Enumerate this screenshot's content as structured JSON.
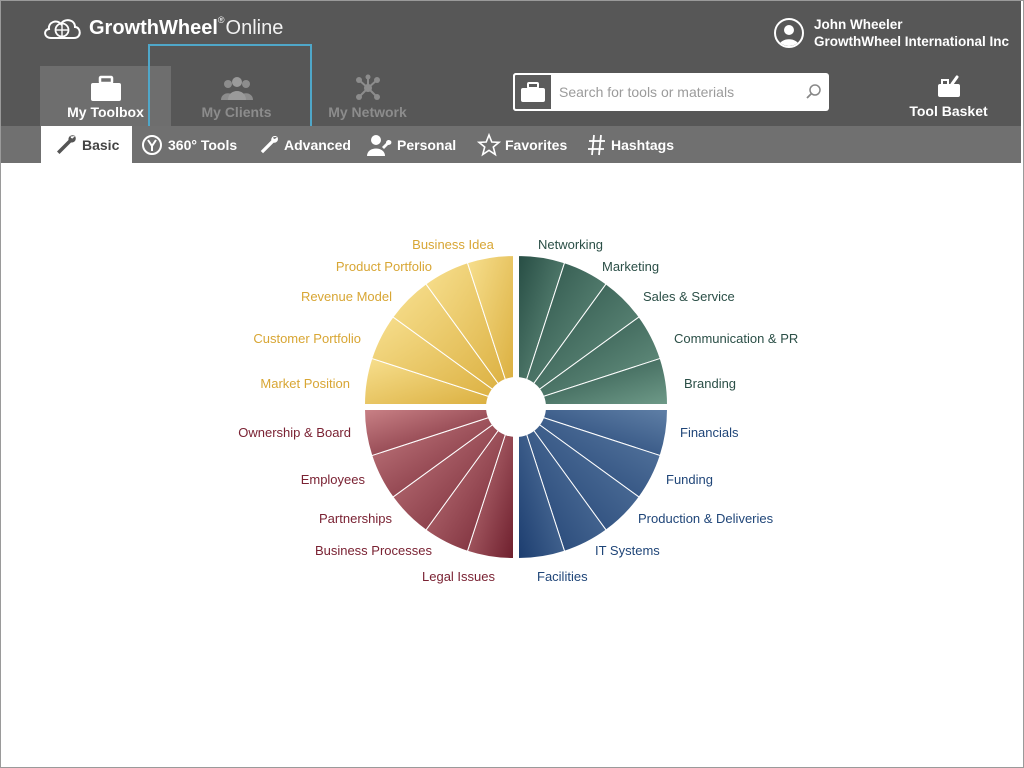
{
  "app": {
    "logo_bold": "GrowthWheel",
    "logo_reg": "®",
    "logo_thin": "Online"
  },
  "user": {
    "name": "John Wheeler",
    "company": "GrowthWheel International Inc"
  },
  "nav": {
    "toolbox": "My Toolbox",
    "clients": "My Clients",
    "network": "My Network",
    "basket": "Tool Basket"
  },
  "search": {
    "placeholder": "Search for tools or materials",
    "value": ""
  },
  "subnav": {
    "basic": "Basic",
    "tools360": "360° Tools",
    "advanced": "Advanced",
    "personal": "Personal",
    "favorites": "Favorites",
    "hashtags": "Hashtags"
  },
  "colors": {
    "header": "#575757",
    "subnav": "#707070",
    "highlight": "#4fa7c9",
    "yellow": "#e0b54a",
    "green": "#3d6b5e",
    "blue": "#244a7b",
    "red": "#7a2a36"
  },
  "wheel": {
    "quadrants": [
      {
        "name": "yellow",
        "color_text": "#d8a634",
        "labels": [
          "Business Idea",
          "Product Portfolio",
          "Revenue Model",
          "Customer Portfolio",
          "Market Position"
        ]
      },
      {
        "name": "green",
        "color_text": "#2b4f47",
        "labels": [
          "Networking",
          "Marketing",
          "Sales & Service",
          "Communication & PR",
          "Branding"
        ]
      },
      {
        "name": "blue",
        "color_text": "#1f4578",
        "labels": [
          "Financials",
          "Funding",
          "Production & Deliveries",
          "IT Systems",
          "Facilities"
        ]
      },
      {
        "name": "red",
        "color_text": "#7a2233",
        "labels": [
          "Ownership & Board",
          "Employees",
          "Partnerships",
          "Business Processes",
          "Legal Issues"
        ]
      }
    ]
  }
}
